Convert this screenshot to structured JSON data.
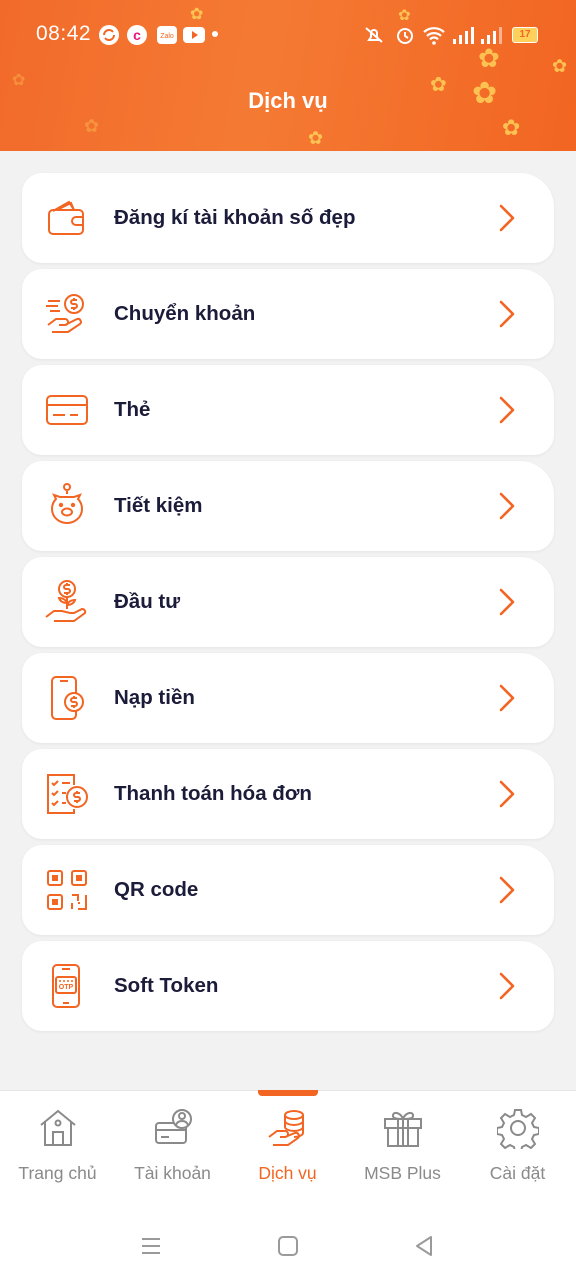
{
  "status_bar": {
    "time": "08:42",
    "battery": "17"
  },
  "header": {
    "title": "Dịch vụ"
  },
  "services": [
    {
      "label": "Đăng kí tài khoản số đẹp",
      "icon": "wallet-icon"
    },
    {
      "label": "Chuyển khoản",
      "icon": "money-transfer-icon"
    },
    {
      "label": "Thẻ",
      "icon": "card-icon"
    },
    {
      "label": "Tiết kiệm",
      "icon": "piggy-bank-icon"
    },
    {
      "label": "Đầu tư",
      "icon": "investment-icon"
    },
    {
      "label": "Nạp tiền",
      "icon": "phone-topup-icon"
    },
    {
      "label": "Thanh toán hóa đơn",
      "icon": "bill-payment-icon"
    },
    {
      "label": "QR code",
      "icon": "qr-code-icon"
    },
    {
      "label": "Soft Token",
      "icon": "otp-token-icon"
    }
  ],
  "bottom_nav": {
    "active": "Dịch vụ",
    "items": [
      {
        "label": "Trang chủ",
        "icon": "home-icon"
      },
      {
        "label": "Tài khoản",
        "icon": "account-icon"
      },
      {
        "label": "Dịch vụ",
        "icon": "services-icon"
      },
      {
        "label": "MSB Plus",
        "icon": "gift-icon"
      },
      {
        "label": "Cài đặt",
        "icon": "settings-icon"
      }
    ]
  },
  "colors": {
    "brand_orange": "#f26522",
    "text_dark": "#1b1b3a",
    "nav_inactive": "#8a8a8a"
  }
}
